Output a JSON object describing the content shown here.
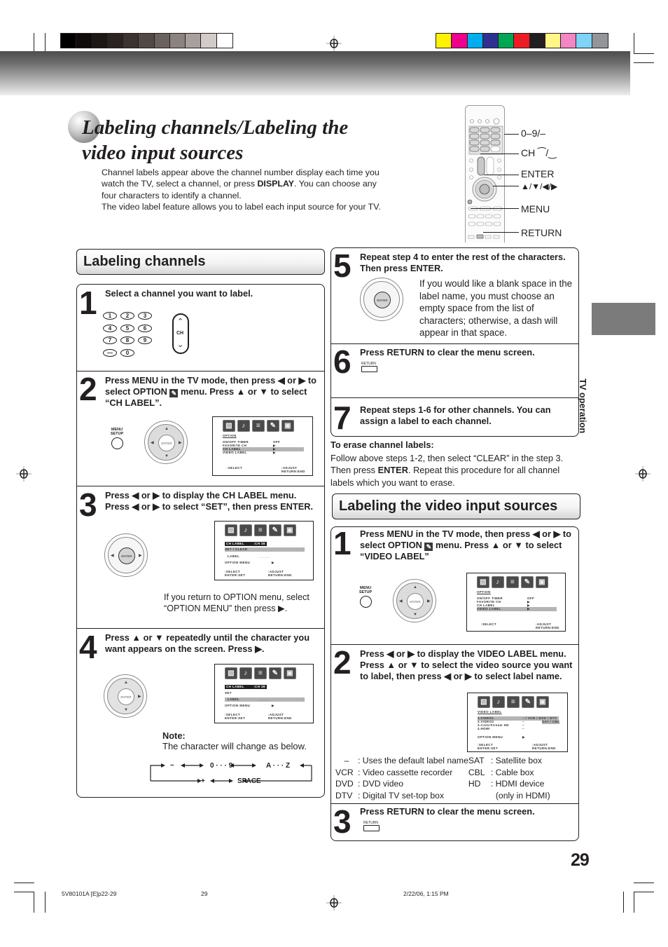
{
  "page": {
    "title": "Labeling channels/Labeling the video input sources",
    "intro_p1_a": "Channel labels appear above the channel number display each time you watch the TV, select a channel, or press ",
    "intro_p1_bold": "DISPLAY",
    "intro_p1_b": ". You can choose any four characters to identify a channel.",
    "intro_p2": "The video label feature allows you to label each input source for your TV.",
    "page_number": "29",
    "side_tab_label": "TV operation"
  },
  "colors": {
    "gray_swatches": [
      "#000000",
      "#0f0b0a",
      "#1c1715",
      "#2a2321",
      "#3c3230",
      "#524947",
      "#6b615e",
      "#8c8280",
      "#a9a09e",
      "#d3cbc9",
      "#ffffff"
    ],
    "color_swatches": [
      "#fff200",
      "#ec008c",
      "#00aeef",
      "#2e3192",
      "#00a651",
      "#ed1c24",
      "#231f20",
      "#fff685",
      "#f386c4",
      "#7ed3f7",
      "#939598"
    ]
  },
  "remote_labels": {
    "digits": "0–9/–",
    "ch": "CH ⁀/‿",
    "enter": "ENTER",
    "arrows": "▲/▼/◀/▶",
    "menu": "MENU",
    "return": "RETURN"
  },
  "labeling_channels": {
    "heading": "Labeling channels",
    "steps": [
      {
        "num": "1",
        "text": "Select a channel you want to label."
      },
      {
        "num": "2",
        "text_a": "Press MENU in the TV mode, then press ◀ or ▶ to select OPTION ",
        "text_b": " menu. Press ▲ or ▼ to select “CH LABEL”."
      },
      {
        "num": "3",
        "text": "Press ◀ or ▶ to display the CH LABEL menu. Press ◀ or ▶ to select “SET”, then press ENTER.",
        "note": "If you return to OPTION menu, select “OPTION MENU” then press ▶."
      },
      {
        "num": "4",
        "text": "Press ▲ or ▼ repeatedly until the character you want appears on the screen. Press ▶.",
        "note_title": "Note:",
        "note": "The character will change as below."
      },
      {
        "num": "5",
        "text": "Repeat step 4 to enter the rest of the characters. Then press ENTER.",
        "note": "If you would like a blank space in the label name, you must choose an empty space from the list of characters; otherwise, a dash will appear in that space."
      },
      {
        "num": "6",
        "text": "Press RETURN to clear the menu screen."
      },
      {
        "num": "7",
        "text": "Repeat steps 1-6 for other channels. You can assign a label to each channel."
      }
    ],
    "keypad": [
      "1",
      "2",
      "3",
      "4",
      "5",
      "6",
      "7",
      "8",
      "9",
      "—",
      "0"
    ],
    "ch_rocker": "CH",
    "char_cycle": {
      "top": [
        "–",
        "0 · · · 9",
        "A · · · Z"
      ],
      "bottom": [
        "+",
        "SPACE"
      ]
    },
    "erase": {
      "title": "To erase channel labels:",
      "text_a": "Follow above steps 1-2, then select “CLEAR” in the step 3. Then press ",
      "text_bold": "ENTER",
      "text_b": ". Repeat this procedure for all channel labels which you want to erase."
    }
  },
  "labeling_video": {
    "heading": "Labeling the video input sources",
    "steps": [
      {
        "num": "1",
        "text_a": "Press MENU in the TV mode, then press ◀ or ▶ to select OPTION ",
        "text_b": " menu. Press ▲ or ▼ to select “VIDEO LABEL”"
      },
      {
        "num": "2",
        "text": "Press ◀ or ▶ to display the VIDEO LABEL menu. Press ▲ or ▼ to select the video source you want to label, then press ◀ or ▶ to select label name."
      },
      {
        "num": "3",
        "text": "Press RETURN to clear the menu screen."
      }
    ],
    "legend": [
      {
        "code": "–",
        "desc": ": Uses the default label name",
        "code2": "SAT",
        "desc2": ": Satellite box"
      },
      {
        "code": "VCR",
        "desc": ": Video cassette recorder",
        "code2": "CBL",
        "desc2": ": Cable box"
      },
      {
        "code": "DVD",
        "desc": ": DVD video",
        "code2": "HD",
        "desc2": ": HDMI device"
      },
      {
        "code": "DTV",
        "desc": ": Digital TV set-top box",
        "code2": "",
        "desc2": "(only in HDMI)"
      }
    ]
  },
  "osd": {
    "option_title": "OPTION",
    "option_rows": [
      "ON/OFF TIMER",
      "FAVORITE CH",
      "CH LABEL",
      "VIDEO LABEL"
    ],
    "option_vals": [
      "OFF",
      "▶",
      "▶",
      "▶"
    ],
    "select": ":SELECT",
    "adjust": ":ADJUST",
    "return_end": "RETURN:END",
    "enter_set": "ENTER:SET",
    "ch_label_title": "CH LABEL",
    "ch_value": ":CH  38",
    "set_clear": "SET / CLEAR",
    "set": "SET",
    "label": "LABEL",
    "label_val": "_ _ _ _",
    "option_menu": "OPTION MENU",
    "arrow": "▶",
    "video_label_title": "VIDEO LABEL",
    "video_rows": [
      "1.VIDEO1",
      "2.VIDEO2",
      "3.ColorStream   HD",
      "4.HDMI"
    ],
    "video_opts_1": "– / VCR / DVD / DTV",
    "video_opts_2": "SAT / CBL",
    "dash": "–"
  },
  "buttons": {
    "menu_setup": "MENU\nSETUP",
    "return": "RETURN",
    "enter": "ENTER"
  },
  "footer": {
    "file": "5V80101A [E]p22-29",
    "page": "29",
    "date": "2/22/06, 1:15 PM"
  }
}
